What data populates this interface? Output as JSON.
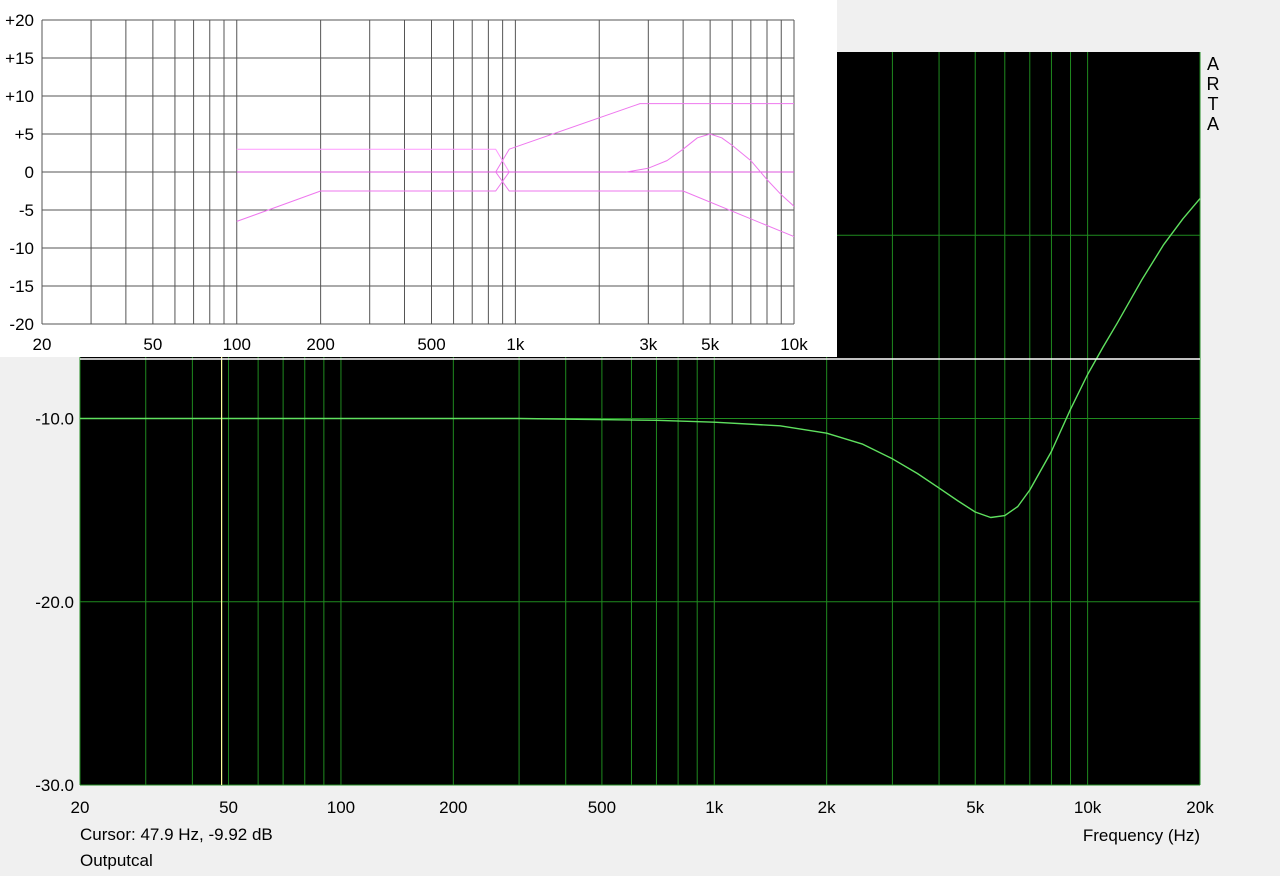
{
  "chart_data": [
    {
      "type": "line",
      "title": "",
      "xlabel": "Frequency (Hz)",
      "ylabel": "",
      "x_scale": "log",
      "xlim": [
        20,
        20000
      ],
      "ylim": [
        -30,
        10
      ],
      "grid": true,
      "background_color": "#000000",
      "grid_color": "#1f8a1f",
      "x_ticks": [
        {
          "value": 20,
          "label": "20"
        },
        {
          "value": 50,
          "label": "50"
        },
        {
          "value": 100,
          "label": "100"
        },
        {
          "value": 200,
          "label": "200"
        },
        {
          "value": 500,
          "label": "500"
        },
        {
          "value": 1000,
          "label": "1k"
        },
        {
          "value": 2000,
          "label": "2k"
        },
        {
          "value": 5000,
          "label": "5k"
        },
        {
          "value": 10000,
          "label": "10k"
        },
        {
          "value": 20000,
          "label": "20k"
        }
      ],
      "y_ticks": [
        {
          "value": -10,
          "label": "-10.0"
        },
        {
          "value": -20,
          "label": "-20.0"
        },
        {
          "value": -30,
          "label": "-30.0"
        }
      ],
      "watermark": "ARTA",
      "cursor": {
        "frequency": 47.9,
        "level": -9.92,
        "label": "Cursor: 47.9 Hz, -9.92 dB",
        "color": "#ffff99"
      },
      "caption": "Outputcal",
      "series": [
        {
          "color": "#5fe05f",
          "points": [
            [
              20,
              -10.0
            ],
            [
              100,
              -10.0
            ],
            [
              300,
              -10.0
            ],
            [
              700,
              -10.1
            ],
            [
              1000,
              -10.2
            ],
            [
              1500,
              -10.4
            ],
            [
              2000,
              -10.8
            ],
            [
              2500,
              -11.4
            ],
            [
              3000,
              -12.2
            ],
            [
              3500,
              -13.0
            ],
            [
              4000,
              -13.8
            ],
            [
              4500,
              -14.5
            ],
            [
              5000,
              -15.1
            ],
            [
              5500,
              -15.4
            ],
            [
              6000,
              -15.3
            ],
            [
              6500,
              -14.8
            ],
            [
              7000,
              -13.9
            ],
            [
              8000,
              -11.8
            ],
            [
              9000,
              -9.5
            ],
            [
              10000,
              -7.6
            ],
            [
              11000,
              -6.1
            ],
            [
              12000,
              -4.8
            ],
            [
              14000,
              -2.4
            ],
            [
              16000,
              -0.5
            ],
            [
              18000,
              0.9
            ],
            [
              20000,
              2.0
            ]
          ]
        }
      ]
    },
    {
      "type": "line",
      "title": "",
      "xlabel": "",
      "ylabel": "",
      "x_scale": "log",
      "xlim": [
        20,
        10000
      ],
      "ylim": [
        -20,
        20
      ],
      "grid": true,
      "background_color": "#ffffff",
      "grid_color": "#555555",
      "x_ticks": [
        {
          "value": 20,
          "label": "20"
        },
        {
          "value": 50,
          "label": "50"
        },
        {
          "value": 100,
          "label": "100"
        },
        {
          "value": 200,
          "label": "200"
        },
        {
          "value": 500,
          "label": "500"
        },
        {
          "value": 1000,
          "label": "1k"
        },
        {
          "value": 3000,
          "label": "3k"
        },
        {
          "value": 5000,
          "label": "5k"
        },
        {
          "value": 10000,
          "label": "10k"
        }
      ],
      "y_ticks": [
        {
          "value": 20,
          "label": "+20"
        },
        {
          "value": 15,
          "label": "+15"
        },
        {
          "value": 10,
          "label": "+10"
        },
        {
          "value": 5,
          "label": "+5"
        },
        {
          "value": 0,
          "label": "0"
        },
        {
          "value": -5,
          "label": "-5"
        },
        {
          "value": -10,
          "label": "-10"
        },
        {
          "value": -15,
          "label": "-15"
        },
        {
          "value": -20,
          "label": "-20"
        }
      ],
      "series": [
        {
          "color": "#ff99ff",
          "points": [
            [
              100,
              3
            ],
            [
              850,
              3
            ],
            [
              950,
              0
            ]
          ]
        },
        {
          "color": "#dd55dd",
          "points": [
            [
              100,
              0
            ],
            [
              10000,
              0
            ]
          ]
        },
        {
          "color": "#ee77ee",
          "points": [
            [
              100,
              -6.5
            ],
            [
              200,
              -2.5
            ],
            [
              850,
              -2.5
            ],
            [
              950,
              0
            ]
          ]
        },
        {
          "color": "#ee77ee",
          "points": [
            [
              850,
              0
            ],
            [
              950,
              -2.5
            ],
            [
              4000,
              -2.5
            ],
            [
              10000,
              -8.5
            ]
          ]
        },
        {
          "color": "#ee77ee",
          "points": [
            [
              850,
              0
            ],
            [
              950,
              3
            ],
            [
              2800,
              9
            ],
            [
              10000,
              9
            ]
          ]
        },
        {
          "color": "#ee77ee",
          "points": [
            [
              2500,
              0
            ],
            [
              3000,
              0.5
            ],
            [
              3500,
              1.5
            ],
            [
              4000,
              3
            ],
            [
              4500,
              4.5
            ],
            [
              5000,
              5
            ],
            [
              5500,
              4.5
            ],
            [
              6000,
              3.5
            ],
            [
              7000,
              1.5
            ],
            [
              8000,
              -1
            ],
            [
              9000,
              -3
            ],
            [
              10000,
              -4.5
            ]
          ]
        }
      ]
    }
  ]
}
